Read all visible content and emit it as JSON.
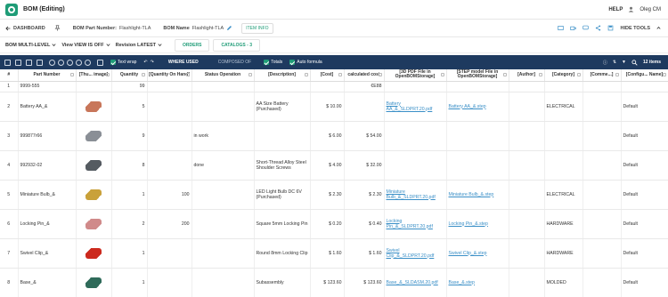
{
  "app": {
    "title": "BOM (Editing)"
  },
  "topright": {
    "help": "HELP",
    "user": "Oleg CM"
  },
  "breadcrumb": {
    "dashboard": "DASHBOARD"
  },
  "bom": {
    "part_number_label": "BOM Part Number:",
    "part_number": "Flashlight-TLA",
    "name_label": "BOM Name",
    "name": "Flashlight-TLA",
    "item_info": "ITEM INFO"
  },
  "tools": {
    "hide_tools": "HIDE TOOLS"
  },
  "viewbar": {
    "bom_type": "BOM MULTI-LEVEL",
    "view": "View VIEW IS OFF",
    "revision": "Revision LATEST",
    "tab_orders": "ORDERS",
    "tab_catalogs": "CATALOGS - 3"
  },
  "toolbar": {
    "text_wrap": "Text wrap",
    "where_used": "WHERE USED",
    "composed_of": "COMPOSED OF",
    "totals": "Totals",
    "auto_formula": "Auto formula",
    "items_count": "12 items"
  },
  "columns": [
    "#",
    "Part Number",
    "[Thu... image]",
    "Quantity",
    "[Quantity On Hand]",
    "Status Operation",
    "[Description]",
    "[Cost]",
    "calculated cost",
    "[3D PDF File in OpenBOMStorage]",
    "[STEP model File in OpenBOMStorage]",
    "[Author]",
    "[Category]",
    "[Comme...]",
    "[Configu... Name]"
  ],
  "rows": [
    {
      "num": "1",
      "part": "9999-555",
      "qty": "99",
      "onhand": "",
      "status": "",
      "desc": "",
      "cost": "",
      "calc": "€E88",
      "pdf": "",
      "step": "",
      "author": "",
      "category": "",
      "comment": "",
      "config": "",
      "thumb": ""
    },
    {
      "num": "2",
      "part": "Battery AA_&",
      "qty": "5",
      "onhand": "",
      "status": "",
      "desc": "AA Size Battery (Purchased)",
      "cost": "$ 10.00",
      "calc": "",
      "pdf": "Battery AA_&_SLDPRT.20.pdf",
      "step": "Battery AA_&.step",
      "author": "",
      "category": "ELECTRICAL",
      "comment": "",
      "config": "Default",
      "thumb": "#c8765a"
    },
    {
      "num": "3",
      "part": "999877r66",
      "qty": "9",
      "onhand": "",
      "status": "in work",
      "desc": "",
      "cost": "$ 6.00",
      "calc": "$ 54.00",
      "pdf": "",
      "step": "",
      "author": "",
      "category": "",
      "comment": "",
      "config": "Default",
      "thumb": "#8a8f96"
    },
    {
      "num": "4",
      "part": "992932-02",
      "qty": "8",
      "onhand": "",
      "status": "done",
      "desc": "Short-Thread Alloy Steel Shoulder Screws",
      "cost": "$ 4.00",
      "calc": "$ 32.00",
      "pdf": "",
      "step": "",
      "author": "",
      "category": "",
      "comment": "",
      "config": "Default",
      "thumb": "#555b61"
    },
    {
      "num": "5",
      "part": "Miniature Bulb_&",
      "qty": "1",
      "onhand": "100",
      "status": "",
      "desc": "LED Light Bulb DC 6V (Purchased)",
      "cost": "$ 2.30",
      "calc": "$ 2.30",
      "pdf": "Miniature Bulb_&_SLDPRT.20.pdf",
      "step": "Miniature Bulb_&.step",
      "author": "",
      "category": "ELECTRICAL",
      "comment": "",
      "config": "Default",
      "thumb": "#c9a13a"
    },
    {
      "num": "6",
      "part": "Locking Pin_&",
      "qty": "2",
      "onhand": "200",
      "status": "",
      "desc": "Square 5mm Locking Pin",
      "cost": "$ 0.20",
      "calc": "$ 0.40",
      "pdf": "Locking Pin_&_SLDPRT.20.pdf",
      "step": "Locking Pin_&.step",
      "author": "",
      "category": "HARDWARE",
      "comment": "",
      "config": "Default",
      "thumb": "#d08a8a"
    },
    {
      "num": "7",
      "part": "Swivel Clip_&",
      "qty": "1",
      "onhand": "",
      "status": "",
      "desc": "Round 8mm Locking Clip",
      "cost": "$ 1.60",
      "calc": "$ 1.60",
      "pdf": "Swivel Clip_&_SLDPRT.20.pdf",
      "step": "Swivel Clip_&.step",
      "author": "",
      "category": "HARDWARE",
      "comment": "",
      "config": "Default",
      "thumb": "#cc2a1e"
    },
    {
      "num": "8",
      "part": "Base_&",
      "qty": "1",
      "onhand": "",
      "status": "",
      "desc": "Subassembly",
      "cost": "$ 123.60",
      "calc": "$ 123.60",
      "pdf": "Base_&_SLDASM.20.pdf",
      "step": "Base_&.step",
      "author": "",
      "category": "MOLDED",
      "comment": "",
      "config": "Default",
      "thumb": "#2f6b5a"
    }
  ],
  "colors": {
    "brand": "#1f9c77",
    "toolbar": "#1e3a5f",
    "link": "#3a8fc7"
  }
}
